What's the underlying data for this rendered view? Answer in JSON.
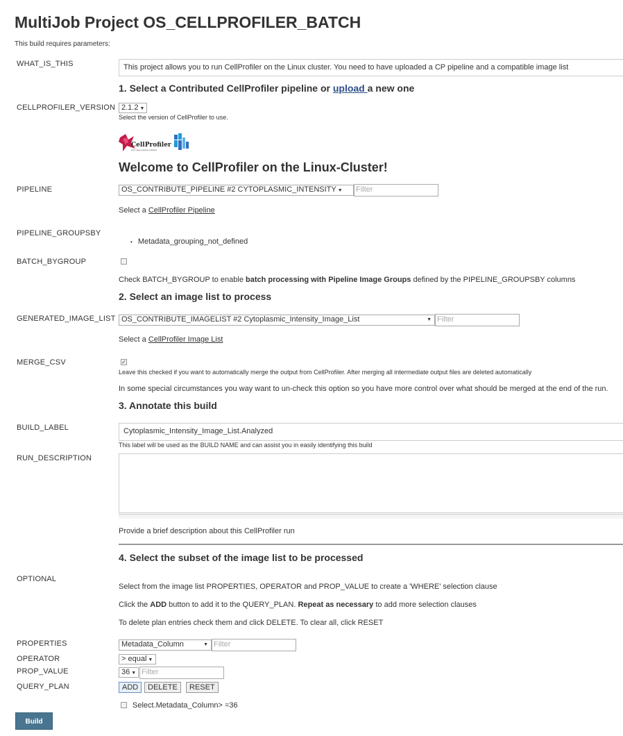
{
  "page": {
    "title": "MultiJob Project OS_CELLPROFILER_BATCH",
    "subtitle": "This build requires parameters:",
    "build_button": "Build"
  },
  "params": {
    "what_is_this": {
      "label": "WHAT_IS_THIS",
      "value": "This project allows you to run CellProfiler on the Linux cluster. You need to have uploaded a CP pipeline and a compatible image list"
    },
    "section1": {
      "prefix": "1. Select a Contributed CellProfiler pipeline or ",
      "link": "upload ",
      "suffix": "a new one"
    },
    "cellprofiler_version": {
      "label": "CELLPROFILER_VERSION",
      "selected": "2.1.2",
      "help": "Select the version of CellProfiler to use."
    },
    "logo": {
      "text": "CellProfiler",
      "tagline": "cell image analysis software"
    },
    "welcome": "Welcome to CellProfiler on the Linux-Cluster!",
    "pipeline": {
      "label": "PIPELINE",
      "selected": "OS_CONTRIBUTE_PIPELINE #2 CYTOPLASMIC_INTENSITY",
      "filter_placeholder": "Filter",
      "help_prefix": "Select a ",
      "help_link": "CellProfiler Pipeline"
    },
    "pipeline_groupsby": {
      "label": "PIPELINE_GROUPSBY",
      "item": "Metadata_grouping_not_defined"
    },
    "batch_bygroup": {
      "label": "BATCH_BYGROUP",
      "checked": false,
      "help_a": "Check BATCH_BYGROUP to enable ",
      "help_b": "batch processing with Pipeline Image Groups",
      "help_c": " defined by the PIPELINE_GROUPSBY columns"
    },
    "section2": "2. Select an image list to process",
    "generated_image_list": {
      "label": "GENERATED_IMAGE_LIST",
      "selected": "OS_CONTRIBUTE_IMAGELIST #2 Cytoplasmic_Intensity_Image_List",
      "filter_placeholder": "Filter",
      "help_prefix": "Select a ",
      "help_link": "CellProfiler Image List"
    },
    "merge_csv": {
      "label": "MERGE_CSV",
      "checked": true,
      "help_small": "Leave this checked if you want to automatically merge the output from CellProfiler. After merging all intermediate output files are deleted automatically",
      "help_text": "In some special circumstances you way want to un-check this option so you have more control over what should be merged at the end of the run."
    },
    "section3": "3. Annotate this build",
    "build_label": {
      "label": "BUILD_LABEL",
      "value": "Cytoplasmic_Intensity_Image_List.Analyzed",
      "help": "This label will be used as the BUILD NAME and can assist you in easily identifying this build"
    },
    "run_description": {
      "label": "RUN_DESCRIPTION",
      "value": "",
      "help": "Provide a brief description about this CellProfiler run"
    },
    "section4": "4. Select the subset of the image list to be processed",
    "optional": {
      "label": "OPTIONAL",
      "line1": "Select from the image list PROPERTIES, OPERATOR and PROP_VALUE to create a 'WHERE' selection clause",
      "line2_a": "Click the ",
      "line2_b": "ADD",
      "line2_c": " button to add it to the QUERY_PLAN. ",
      "line2_d": "Repeat as necessary",
      "line2_e": " to add more selection clauses",
      "line3": "To delete plan entries check them and click DELETE. To clear all, click RESET"
    },
    "properties": {
      "label": "PROPERTIES",
      "selected": "Metadata_Column",
      "filter_placeholder": "Filter"
    },
    "operator": {
      "label": "OPERATOR",
      "selected": "> equal"
    },
    "prop_value": {
      "label": "PROP_VALUE",
      "selected": "36",
      "filter_placeholder": "Filter"
    },
    "query_plan": {
      "label": "QUERY_PLAN",
      "add": "ADD",
      "delete": "DELETE",
      "reset": "RESET",
      "entries": [
        {
          "text": "Select.Metadata_Column> =36",
          "checked": false
        }
      ]
    }
  },
  "colors": {
    "build_button": "#4a7590",
    "upload_link": "#2a4e8a"
  }
}
